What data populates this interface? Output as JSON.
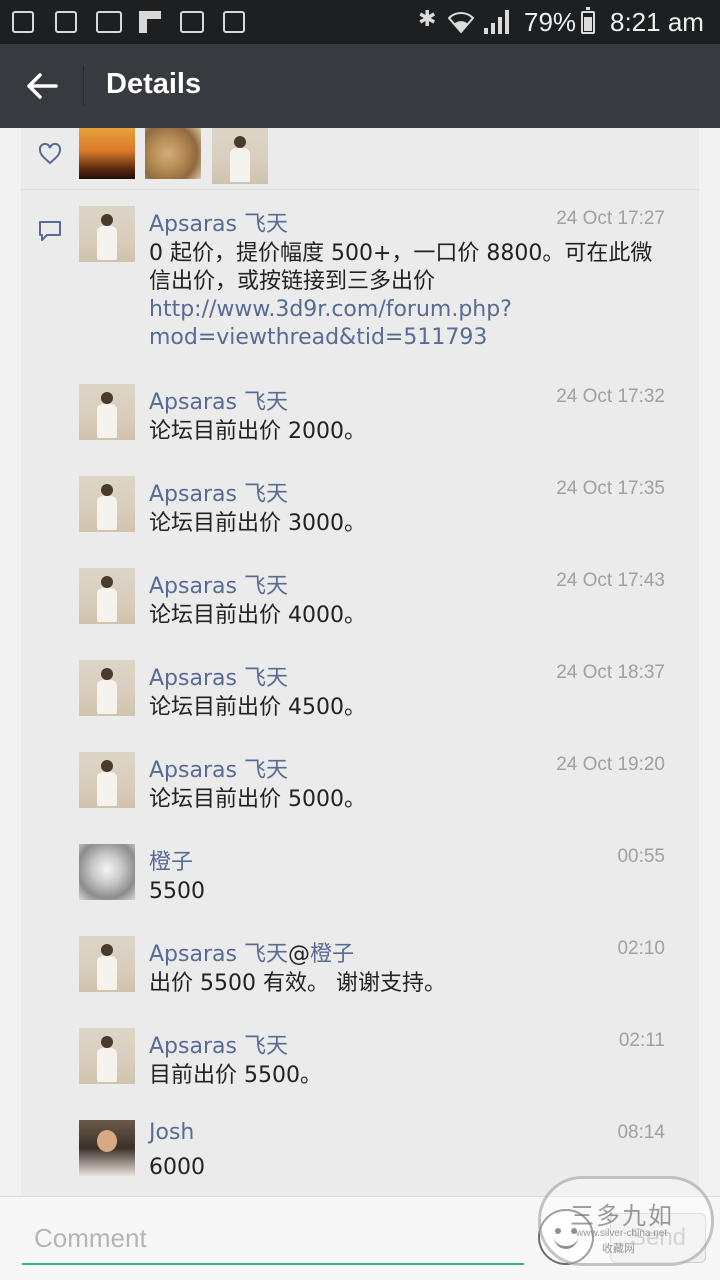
{
  "status_bar": {
    "battery": "79%",
    "time": "8:21 am",
    "icons": [
      "sim-icon",
      "gallery-icon",
      "email-icon",
      "flipboard-icon",
      "mail-forward-icon",
      "gallery-icon",
      "bluetooth-icon",
      "wifi-icon",
      "signal-icon",
      "battery-icon"
    ]
  },
  "header": {
    "title": "Details",
    "back_icon": "arrow-left-icon"
  },
  "likes": {
    "icon": "heart-icon",
    "avatar_count": 3
  },
  "comments": [
    {
      "name": "Apsaras 飞天",
      "reply_to": "",
      "time": "24 Oct 17:27",
      "text": "0 起价，提价幅度 500+，一口价 8800。可在此微信出价，或按链接到三多出价 ",
      "link": "http://www.3d9r.com/forum.php?mod=viewthread&tid=511793"
    },
    {
      "name": "Apsaras 飞天",
      "reply_to": "",
      "time": "24 Oct 17:32",
      "text": "论坛目前出价 2000。",
      "link": ""
    },
    {
      "name": "Apsaras 飞天",
      "reply_to": "",
      "time": "24 Oct 17:35",
      "text": "论坛目前出价 3000。",
      "link": ""
    },
    {
      "name": "Apsaras 飞天",
      "reply_to": "",
      "time": "24 Oct 17:43",
      "text": "论坛目前出价 4000。",
      "link": ""
    },
    {
      "name": "Apsaras 飞天",
      "reply_to": "",
      "time": "24 Oct 18:37",
      "text": "论坛目前出价 4500。",
      "link": ""
    },
    {
      "name": "Apsaras 飞天",
      "reply_to": "",
      "time": "24 Oct 19:20",
      "text": "论坛目前出价 5000。",
      "link": ""
    },
    {
      "name": "橙子",
      "reply_to": "",
      "time": "00:55",
      "text": "5500",
      "link": ""
    },
    {
      "name": "Apsaras 飞天",
      "reply_to": "橙子",
      "time": "02:10",
      "text": "出价 5500 有效。 谢谢支持。",
      "link": ""
    },
    {
      "name": "Apsaras 飞天",
      "reply_to": "",
      "time": "02:11",
      "text": "目前出价 5500。",
      "link": ""
    },
    {
      "name": "Josh",
      "reply_to": "",
      "time": "08:14",
      "text": "6000",
      "link": ""
    }
  ],
  "comment_bar": {
    "placeholder": "Comment",
    "emoji_icon": "emoji-icon",
    "send_label": "Send"
  },
  "watermark": {
    "title": "三多九如",
    "url": "www.silver-china.net",
    "caption": "收藏网"
  },
  "colors": {
    "status_bar_bg": "#1d1f20",
    "header_bg": "#393a3f",
    "name_link": "#576b95",
    "input_underline": "#3cb371"
  }
}
